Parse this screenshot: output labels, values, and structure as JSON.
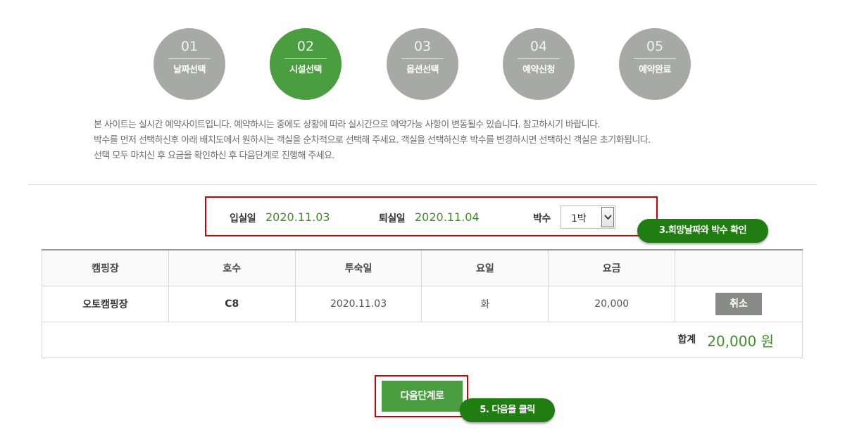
{
  "steps": [
    {
      "num": "01",
      "label": "날짜선택",
      "active": false
    },
    {
      "num": "02",
      "label": "시설선택",
      "active": true
    },
    {
      "num": "03",
      "label": "옵션선택",
      "active": false
    },
    {
      "num": "04",
      "label": "예약신청",
      "active": false
    },
    {
      "num": "05",
      "label": "예약완료",
      "active": false
    }
  ],
  "notice": [
    "본 사이트는 실시간 예약사이트입니다. 예약하시는 중에도 상황에 따라 실시간으로 예약가능 사항이 변동될수 있습니다. 참고하시기 바랍니다.",
    "박수를 먼저 선택하신후 아래 배치도에서 원하시는 객실을 순차적으로 선택해 주세요. 객실을 선택하신후 박수를 변경하시면 선택하신 객실은 초기화됩니다.",
    "선택 모두 마치신 후 요금을 확인하신 후 다음단계로 진행해 주세요."
  ],
  "dates": {
    "checkin_label": "입실일",
    "checkin": "2020.11.03",
    "checkout_label": "퇴실일",
    "checkout": "2020.11.04",
    "nights_label": "박수",
    "nights_value": "1박"
  },
  "annotations": {
    "step3": "3.희망날짜와 박수 확인",
    "step5": "5. 다음을 클릭"
  },
  "table": {
    "headers": [
      "캠핑장",
      "호수",
      "투숙일",
      "요일",
      "요금",
      ""
    ],
    "row": {
      "site": "오토캠핑장",
      "room": "C8",
      "date": "2020.11.03",
      "day": "화",
      "price": "20,000",
      "cancel": "취소"
    },
    "total_label": "합계",
    "total_value": "20,000 원"
  },
  "next_label": "다음단계로",
  "colors": {
    "accent": "#4a9e40",
    "step_inactive": "#a7aaa4",
    "highlight": "#d40000",
    "badge": "#1f7d12",
    "value_green": "#3e8e2a"
  }
}
